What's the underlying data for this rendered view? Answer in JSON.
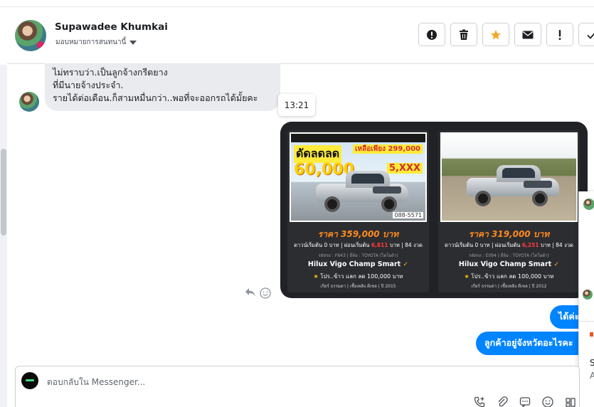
{
  "conversation": {
    "contact_name": "Supawadee Khumkai",
    "assign_label": "มอบหมายการสนทนานี้"
  },
  "header_actions": [
    {
      "name": "mark-spam-button",
      "icon": "exclamation-circle-icon"
    },
    {
      "name": "delete-button",
      "icon": "trash-icon"
    },
    {
      "name": "star-button",
      "icon": "star-icon"
    },
    {
      "name": "mark-unread-button",
      "icon": "envelope-icon"
    },
    {
      "name": "follow-up-button",
      "icon": "exclamation-icon"
    },
    {
      "name": "done-button",
      "icon": "check-icon"
    }
  ],
  "messages": {
    "incoming": {
      "lines": [
        "ไม่ทราบว่า.เป็นลูกจ้างกรีดยาง",
        "ที่มีนายจ้างประจำ.",
        "รายได้ต่อเดือน.ก็สามหมื่นกว่า..พอที่จะออกรถได้มั้ยคะ"
      ],
      "time": "13:21"
    },
    "outgoing": [
      {
        "text": "ได้ค่ะ"
      },
      {
        "text": "ลูกค้าอยู่จังหวัดอะไรคะ"
      }
    ]
  },
  "listings": [
    {
      "promo_big": "ดัดลดลด",
      "promo_num": "60,000",
      "promo_left_price": "เหลือเพียง 299,000",
      "promo_installment": "5,XXX",
      "phone": "088-5571",
      "price": "ราคา 359,000 บาท",
      "down_pre": "ดาวน์เริ่มต้น 0 บาท | ผ่อนเริ่มต้น",
      "down_value": "6,811",
      "down_post": "บาท | 84 งวด",
      "meta": "รหัสรถ : F843 | ยี่ห้อ : TOYOTA (โตโยต้า)",
      "model": "Hilux Vigo Champ Smart",
      "promo": "โปร..ข้าว แลก ลด 100,000 บาท",
      "footer": "เกียร์ ธรรมดา | เชื้อเพลิง ดีเซล | ปี 2015"
    },
    {
      "price": "ราคา 319,000 บาท",
      "down_pre": "ดาวน์เริ่มต้น 0 บาท | ผ่อนเริ่มต้น",
      "down_value": "6,251",
      "down_post": "บาท | 84 งวด",
      "meta": "รหัสรถ : E094 | ยี่ห้อ : TOYOTA (โตโยต้า)",
      "model": "Hilux Vigo Champ Smart",
      "promo": "โปร..ข้าว แลก ลด 100,000 บาท",
      "footer": "เกียร์ ธรรมดา | เชื้อเพลิง ดีเซล | ปี 2012"
    }
  ],
  "side_panel": {
    "text1": "S",
    "text2": "A"
  },
  "composer": {
    "placeholder": "ตอบกลับใน Messenger..."
  },
  "colors": {
    "messenger_blue": "#0084ff",
    "incoming_bubble": "#e9ebee",
    "star_orange": "#f5a623",
    "price_orange": "#ff8a1f"
  }
}
